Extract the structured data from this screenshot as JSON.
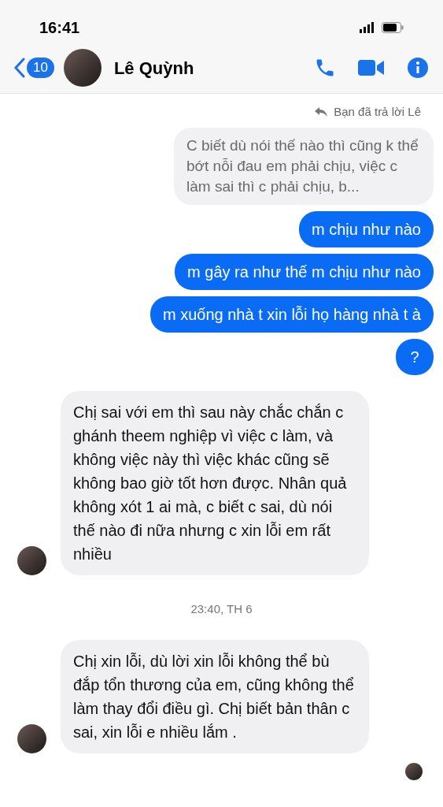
{
  "status_bar": {
    "time": "16:41"
  },
  "header": {
    "back_count": "10",
    "contact_name": "Lê Quỳnh"
  },
  "messages": [
    {
      "kind": "reply_label",
      "text": "Bạn đã trả lời Lê"
    },
    {
      "kind": "quoted",
      "text": "C biết dù nói thế nào thì cũng k thể bớt nỗi đau em phải chịu, việc c làm sai thì c phải chịu, b..."
    },
    {
      "kind": "sent",
      "text": "m chịu như nào"
    },
    {
      "kind": "sent",
      "text": "m gây ra như thế m chịu như nào"
    },
    {
      "kind": "sent",
      "text": "m xuống nhà t xin lỗi họ hàng nhà t à"
    },
    {
      "kind": "sent",
      "text": "?"
    },
    {
      "kind": "received",
      "text": "Chị sai với em thì sau này chắc chắn c ghánh theem nghiệp vì việc c làm, và không việc này thì việc khác cũng sẽ không bao giờ tốt hơn được. Nhân quả không xót 1 ai mà, c biết c sai, dù nói thế nào đi nữa nhưng c xin lỗi em rất nhiều",
      "show_avatar": true
    },
    {
      "kind": "timestamp",
      "text": "23:40, TH 6"
    },
    {
      "kind": "received",
      "text": "Chị xin lỗi, dù lời xin lỗi không thể bù đắp tổn thương của em, cũng không thể làm thay đổi điều gì. Chị biết bản thân c sai, xin lỗi e nhiều lắm .",
      "show_avatar": true
    }
  ],
  "seen": true
}
